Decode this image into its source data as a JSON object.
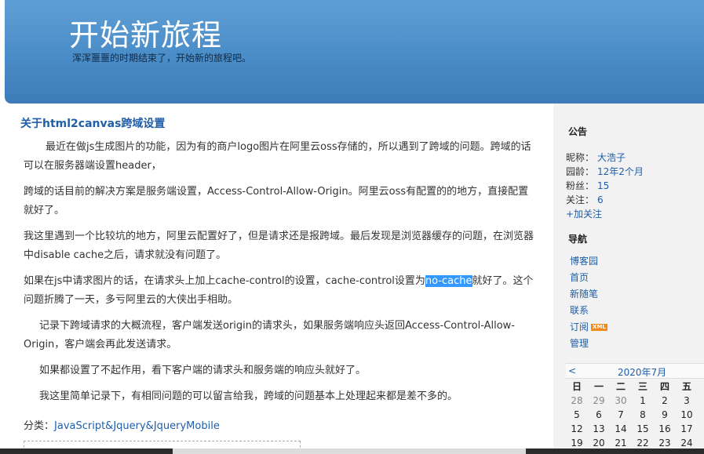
{
  "blog": {
    "title": "开始新旅程",
    "subtitle": "浑浑噩噩的时期结束了，开始新的旅程吧。"
  },
  "post": {
    "title": "关于html2canvas跨域设置",
    "p1": "最近在做js生成图片的功能，因为有的商户logo图片在阿里云oss存储的，所以遇到了跨域的问题。跨域的话可以在服务器端设置header，",
    "p2": "跨域的话目前的解决方案是服务端设置，Access-Control-Allow-Origin。阿里云oss有配置的的地方，直接配置就好了。",
    "p3": "我这里遇到一个比较坑的地方，阿里云配置好了，但是请求还是报跨域。最后发现是浏览器缓存的问题，在浏览器中disable cache之后，请求就没有问题了。",
    "p4_before": "如果在js中请求图片的话，在请求头上加上cache-control的设置，cache-control设置为",
    "p4_highlight": "no-cache",
    "p4_after": "就好了。这个问题折腾了一天，多亏阿里云的大侠出手相助。",
    "p5": "记录下跨域请求的大概流程，客户端发送origin的请求头，如果服务端响应头返回Access-Control-Allow-Origin，客户端会再此发送请求。",
    "p6": "如果都设置了不起作用，看下客户端的请求头和服务端的响应头就好了。",
    "p7": "我这里简单记录下，有相同问题的可以留言给我，跨域的问题基本上处理起来都是差不多的。",
    "category_label": "分类：",
    "category_link": "JavaScript&Jquery&JqueryMobile"
  },
  "sidebar": {
    "notice_heading": "公告",
    "nickname_label": "昵称：",
    "nickname": "大浩子",
    "age_label": "园龄：",
    "age": "12年2个月",
    "fans_label": "粉丝：",
    "fans": "15",
    "follow_label": "关注：",
    "follow": "6",
    "add_follow": "+加关注",
    "nav_heading": "导航",
    "nav": [
      "博客园",
      "首页",
      "新随笔",
      "联系",
      "订阅",
      "管理"
    ],
    "xml_badge": "XML"
  },
  "calendar": {
    "prev": "<",
    "month": "2020年7月",
    "weekdays": [
      "日",
      "一",
      "二",
      "三",
      "四",
      "五"
    ],
    "rows": [
      [
        "28",
        "29",
        "30",
        "1",
        "2",
        "3"
      ],
      [
        "5",
        "6",
        "7",
        "8",
        "9",
        "10"
      ],
      [
        "12",
        "13",
        "14",
        "15",
        "16",
        "17"
      ],
      [
        "19",
        "20",
        "21",
        "22",
        "23",
        "24"
      ]
    ]
  },
  "colors": {
    "header_blue": "#4a8cc7",
    "link_blue": "#1f5ea8",
    "highlight": "#3399ff"
  }
}
